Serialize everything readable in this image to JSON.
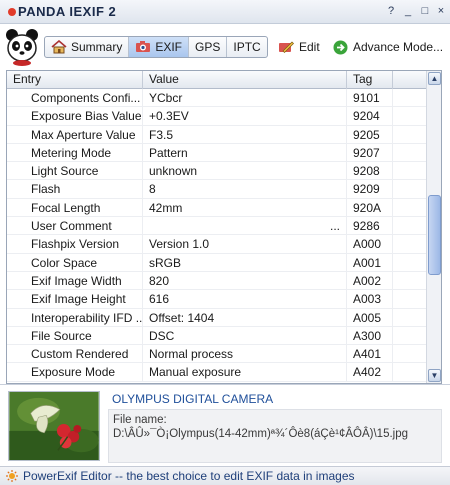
{
  "window": {
    "title": "PANDA IEXIF 2",
    "controls": [
      "?",
      "_",
      "□",
      "×"
    ]
  },
  "toolbar": {
    "tabs": [
      {
        "label": "Summary",
        "icon": "house-icon",
        "active": false
      },
      {
        "label": "EXIF",
        "icon": "exif-icon",
        "active": true
      },
      {
        "label": "GPS",
        "active": false
      },
      {
        "label": "IPTC",
        "active": false
      }
    ],
    "edit_label": "Edit",
    "advance_label": "Advance Mode..."
  },
  "grid": {
    "columns": [
      "Entry",
      "Value",
      "Tag"
    ],
    "rows": [
      {
        "entry": "Components Confi...",
        "value": "YCbcr",
        "extra": "",
        "tag": "9101"
      },
      {
        "entry": "Exposure Bias Value",
        "value": "+0.3EV",
        "extra": "",
        "tag": "9204"
      },
      {
        "entry": "Max Aperture Value",
        "value": "F3.5",
        "extra": "",
        "tag": "9205"
      },
      {
        "entry": "Metering Mode",
        "value": "Pattern",
        "extra": "",
        "tag": "9207"
      },
      {
        "entry": "Light Source",
        "value": "unknown",
        "extra": "",
        "tag": "9208"
      },
      {
        "entry": "Flash",
        "value": "8",
        "extra": "",
        "tag": "9209"
      },
      {
        "entry": "Focal Length",
        "value": "42mm",
        "extra": "",
        "tag": "920A"
      },
      {
        "entry": "User Comment",
        "value": "",
        "extra": "...",
        "tag": "9286"
      },
      {
        "entry": "Flashpix Version",
        "value": "Version 1.0",
        "extra": "",
        "tag": "A000"
      },
      {
        "entry": "Color Space",
        "value": "sRGB",
        "extra": "",
        "tag": "A001"
      },
      {
        "entry": "Exif Image Width",
        "value": "820",
        "extra": "",
        "tag": "A002"
      },
      {
        "entry": "Exif Image Height",
        "value": "616",
        "extra": "",
        "tag": "A003"
      },
      {
        "entry": "Interoperability IFD ...",
        "value": "Offset: 1404",
        "extra": "",
        "tag": "A005"
      },
      {
        "entry": "File Source",
        "value": "DSC",
        "extra": "",
        "tag": "A300"
      },
      {
        "entry": "Custom Rendered",
        "value": "Normal process",
        "extra": "",
        "tag": "A401"
      },
      {
        "entry": "Exposure Mode",
        "value": "Manual exposure",
        "extra": "",
        "tag": "A402"
      }
    ]
  },
  "preview": {
    "camera": "OLYMPUS DIGITAL CAMERA",
    "file_label": "File name:",
    "file_path": "D:\\ÂÛ»¯Ò¡Olympus(14-42mm)ª¾´Ôè8(áÇè¹¢ÂÔÂ)\\15.jpg"
  },
  "status": {
    "text": "PowerExif Editor -- the best choice to edit EXIF data in images"
  },
  "colors": {
    "accent": "#1f4f9a",
    "active_tab": "#a9c6ee",
    "title_dot": "#e23b2a"
  }
}
